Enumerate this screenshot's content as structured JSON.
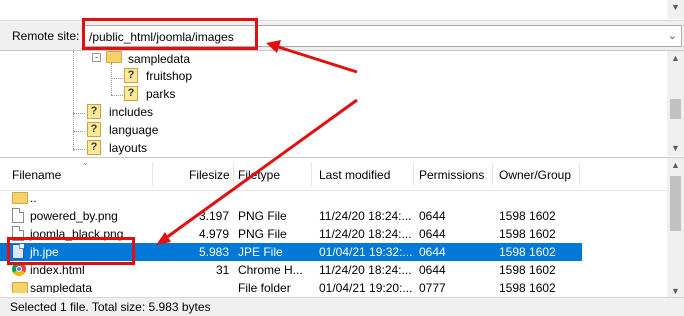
{
  "remote_site": {
    "label": "Remote site:",
    "path": "/public_html/joomla/images"
  },
  "tree": {
    "items": [
      {
        "label": "sampledata",
        "icon": "folder-icon"
      },
      {
        "label": "fruitshop",
        "icon": "unknown-folder-icon"
      },
      {
        "label": "parks",
        "icon": "unknown-folder-icon"
      },
      {
        "label": "includes",
        "icon": "unknown-folder-icon"
      },
      {
        "label": "language",
        "icon": "unknown-folder-icon"
      },
      {
        "label": "layouts",
        "icon": "unknown-folder-icon"
      }
    ]
  },
  "file_list": {
    "columns": [
      "Filename",
      "Filesize",
      "Filetype",
      "Last modified",
      "Permissions",
      "Owner/Group"
    ],
    "rows": [
      {
        "name": "..",
        "size": "",
        "type": "",
        "modified": "",
        "perms": "",
        "owner": "",
        "icon": "folder-icon"
      },
      {
        "name": "powered_by.png",
        "size": "3.197",
        "type": "PNG File",
        "modified": "11/24/20 18:24:...",
        "perms": "0644",
        "owner": "1598 1602",
        "icon": "image-file-icon"
      },
      {
        "name": "joomla_black.png",
        "size": "4.979",
        "type": "PNG File",
        "modified": "11/24/20 18:24:...",
        "perms": "0644",
        "owner": "1598 1602",
        "icon": "image-file-icon"
      },
      {
        "name": "jh.jpe",
        "size": "5.983",
        "type": "JPE File",
        "modified": "01/04/21 19:32:...",
        "perms": "0644",
        "owner": "1598 1602",
        "icon": "jpe-file-icon",
        "selected": true
      },
      {
        "name": "index.html",
        "size": "31",
        "type": "Chrome H...",
        "modified": "11/24/20 18:24:...",
        "perms": "0644",
        "owner": "1598 1602",
        "icon": "chrome-icon"
      },
      {
        "name": "sampledata",
        "size": "",
        "type": "File folder",
        "modified": "01/04/21 19:20:...",
        "perms": "0777",
        "owner": "1598 1602",
        "icon": "folder-icon"
      }
    ]
  },
  "status_bar": {
    "text": "Selected 1 file. Total size: 5.983 bytes"
  },
  "colors": {
    "selection": "#0078d7",
    "highlight": "#e01010"
  }
}
